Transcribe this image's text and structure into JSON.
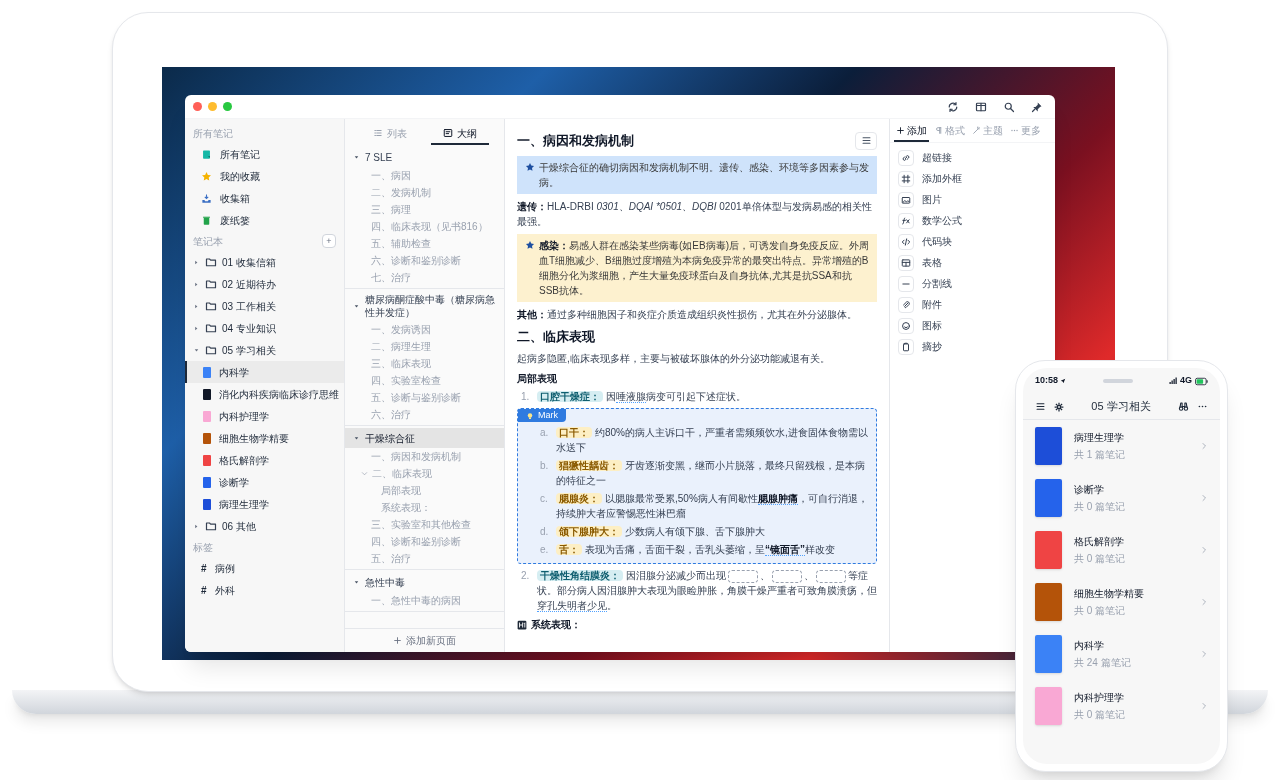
{
  "window": {
    "toolbar": [
      {
        "kind": "refresh"
      },
      {
        "kind": "columns"
      },
      {
        "kind": "search"
      },
      {
        "kind": "pin"
      }
    ]
  },
  "sidebar": {
    "library_header": "所有笔记",
    "library": [
      {
        "kind": "notes",
        "label": "所有笔记"
      },
      {
        "kind": "star",
        "label": "我的收藏"
      },
      {
        "kind": "inbox",
        "label": "收集箱"
      },
      {
        "kind": "trash",
        "label": "废纸篓"
      }
    ],
    "notebooks_header": "笔记本",
    "add_button": "+",
    "notebooks": [
      {
        "label": "01 收集信箱",
        "expanded": false
      },
      {
        "label": "02 近期待办",
        "expanded": false
      },
      {
        "label": "03 工作相关",
        "expanded": false
      },
      {
        "label": "04 专业知识",
        "expanded": false
      },
      {
        "label": "05 学习相关",
        "expanded": true,
        "children": [
          {
            "label": "内科学",
            "color": "#3b82f6",
            "selected": true
          },
          {
            "label": "消化内科疾病临床诊疗思维",
            "color": "#111827",
            "selected": false
          },
          {
            "label": "内科护理学",
            "color": "#f9a8d4",
            "selected": false
          },
          {
            "label": "细胞生物学精要",
            "color": "#b45309",
            "selected": false
          },
          {
            "label": "格氏解剖学",
            "color": "#ef4444",
            "selected": false
          },
          {
            "label": "诊断学",
            "color": "#2563eb",
            "selected": false
          },
          {
            "label": "病理生理学",
            "color": "#1d4ed8",
            "selected": false
          }
        ]
      },
      {
        "label": "06 其他",
        "expanded": false
      }
    ],
    "tags_header": "标签",
    "tags": [
      {
        "symbol": "#",
        "label": "病例"
      },
      {
        "symbol": "#",
        "label": "外科"
      }
    ]
  },
  "outline": {
    "tabs": [
      {
        "kind": "list",
        "label": "列表",
        "selected": false
      },
      {
        "kind": "outline",
        "label": "大纲",
        "selected": true
      }
    ],
    "groups": [
      {
        "title": "7 SLE",
        "expanded": true,
        "selected": false,
        "items": [
          {
            "label": "一、病因"
          },
          {
            "label": "二、发病机制"
          },
          {
            "label": "三、病理"
          },
          {
            "label": "四、临床表现（见书816）"
          },
          {
            "label": "五、辅助检查"
          },
          {
            "label": "六、诊断和鉴别诊断"
          },
          {
            "label": "七、治疗"
          }
        ]
      },
      {
        "title": "糖尿病酮症酸中毒（糖尿病急性并发症）",
        "expanded": true,
        "selected": false,
        "items": [
          {
            "label": "一、发病诱因"
          },
          {
            "label": "二、病理生理"
          },
          {
            "label": "三、临床表现"
          },
          {
            "label": "四、实验室检查"
          },
          {
            "label": "五、诊断与鉴别诊断"
          },
          {
            "label": "六、治疗"
          }
        ]
      },
      {
        "title": "干燥综合征",
        "expanded": true,
        "selected": true,
        "items": [
          {
            "label": "一、病因和发病机制"
          },
          {
            "label": "二、临床表现",
            "expanded": true,
            "children": [
              {
                "label": "局部表现"
              },
              {
                "label": "系统表现："
              }
            ]
          },
          {
            "label": "三、实验室和其他检查"
          },
          {
            "label": "四、诊断和鉴别诊断"
          },
          {
            "label": "五、治疗"
          }
        ]
      },
      {
        "title": "急性中毒",
        "expanded": true,
        "selected": false,
        "items": [
          {
            "label": "一、急性中毒的病因"
          }
        ]
      }
    ],
    "add_button": "添加新页面"
  },
  "editor": {
    "blocks": [
      {
        "kind": "heading",
        "text": "一、病因和发病机制"
      },
      {
        "kind": "callout",
        "color": "#cfe3fb",
        "segments": [
          {
            "text": "干燥综合征的确切病因和发病机制不明。遗传、感染、环境等多因素参与发病。"
          }
        ]
      },
      {
        "kind": "para",
        "segments": [
          {
            "text": "遗传：",
            "kind": "bold"
          },
          {
            "text": "HLA-DRBI "
          },
          {
            "text": "0301",
            "kind": "italic"
          },
          {
            "text": "、"
          },
          {
            "text": "DQAI *0501",
            "kind": "italic"
          },
          {
            "text": "、"
          },
          {
            "text": "DQBI",
            "kind": "italic"
          },
          {
            "text": " 0201单倍体型与发病易感的相关性最强。"
          }
        ]
      },
      {
        "kind": "callout",
        "color": "#fdf1cf",
        "segments": [
          {
            "text": "感染：",
            "kind": "bold"
          },
          {
            "text": "易感人群在感染某些病毒(如EB病毒)后，可诱发自身免疫反应。外周血T细胞减少、B细胞过度增殖为本病免疫异常的最突出特点。异常增殖的B细胞分化为浆细胞，产生大量免疫球蛋白及自身抗体,尤其是抗SSA和抗SSB抗体。"
          }
        ]
      },
      {
        "kind": "para",
        "segments": [
          {
            "text": "其他：",
            "kind": "bold"
          },
          {
            "text": "通过多种细胞因子和炎症介质造成组织炎性损伤，尤其在外分泌腺体。"
          }
        ]
      },
      {
        "kind": "heading",
        "text": "二、临床表现"
      },
      {
        "kind": "para",
        "segments": [
          {
            "text": "起病多隐匿,临床表现多样，主要与被破坏腺体的外分泌功能减退有关。"
          }
        ]
      },
      {
        "kind": "subheading",
        "text": "局部表现"
      },
      {
        "kind": "item",
        "marker": "1.",
        "segments": [
          {
            "text": "口腔干燥症：",
            "kind": "tag_blue"
          },
          {
            "text": "因"
          },
          {
            "text": "唾液腺",
            "kind": "underline"
          },
          {
            "text": "病变可引起下述症状。"
          }
        ]
      },
      {
        "kind": "mark",
        "label": "Mark",
        "items": [
          {
            "marker": "a.",
            "segments": [
              {
                "text": "口干：",
                "kind": "tag_yellow"
              },
              {
                "text": "约80%的病人主诉口干，严重者需频频饮水,进食固体食物需以水送下"
              }
            ]
          },
          {
            "marker": "b.",
            "segments": [
              {
                "text": "猖獗性龋齿：",
                "kind": "tag_yellow"
              },
              {
                "text": "牙齿逐渐变黑，继而小片脱落，最终只留残根，是本病的特征之一"
              }
            ]
          },
          {
            "marker": "c.",
            "segments": [
              {
                "text": "腮腺炎：",
                "kind": "tag_yellow"
              },
              {
                "text": "以腮腺最常受累,50%病人有间歇性"
              },
              {
                "text": "腮腺肿痛",
                "kind": "bold_underline"
              },
              {
                "text": "，可自行消退，持续肿大者应警惕恶性淋巴瘤"
              }
            ]
          },
          {
            "marker": "d.",
            "segments": [
              {
                "text": "颌下腺肿大：",
                "kind": "tag_yellow"
              },
              {
                "text": "少数病人有颌下腺、舌下腺肿大"
              }
            ]
          },
          {
            "marker": "e.",
            "segments": [
              {
                "text": "舌：",
                "kind": "tag_yellow"
              },
              {
                "text": "表现为舌痛，舌面干裂，舌乳头萎缩，呈"
              },
              {
                "text": "“镜面舌”",
                "kind": "bold_underline"
              },
              {
                "text": "样改变"
              }
            ]
          }
        ]
      },
      {
        "kind": "item",
        "marker": "2.",
        "segments": [
          {
            "text": "干燥性角结膜炎：",
            "kind": "tag_blue"
          },
          {
            "text": "因泪腺分泌减少而出现"
          },
          {
            "kind": "blank"
          },
          {
            "text": "、"
          },
          {
            "kind": "blank"
          },
          {
            "text": "、"
          },
          {
            "kind": "blank"
          },
          {
            "text": "等症状。部分病人因泪腺肿大表现为眼睑肿胀，角膜干燥严重者可致角膜溃疡，但"
          },
          {
            "text": "穿孔失明者少见",
            "kind": "underline"
          },
          {
            "text": "。"
          }
        ]
      },
      {
        "kind": "subheading_icon",
        "text": "系统表现："
      }
    ]
  },
  "panel": {
    "tabs": [
      {
        "kind": "plus",
        "label": "添加",
        "selected": true
      },
      {
        "kind": "format",
        "label": "格式",
        "selected": false
      },
      {
        "kind": "theme",
        "label": "主题",
        "selected": false
      },
      {
        "kind": "more",
        "label": "更多",
        "selected": false
      }
    ],
    "items": [
      {
        "kind": "link",
        "label": "超链接"
      },
      {
        "kind": "frame",
        "label": "添加外框"
      },
      {
        "kind": "image",
        "label": "图片"
      },
      {
        "kind": "formula",
        "label": "数学公式"
      },
      {
        "kind": "code",
        "label": "代码块"
      },
      {
        "kind": "table",
        "label": "表格"
      },
      {
        "kind": "divider",
        "label": "分割线"
      },
      {
        "kind": "attachment",
        "label": "附件"
      },
      {
        "kind": "emoji",
        "label": "图标"
      },
      {
        "kind": "clip",
        "label": "摘抄"
      }
    ]
  },
  "phone": {
    "time": "10:58",
    "network": "4G",
    "title": "05 学习相关",
    "books": [
      {
        "title": "病理生理学",
        "count": "共 1 篇笔记",
        "color": "#1d4ed8"
      },
      {
        "title": "诊断学",
        "count": "共 0 篇笔记",
        "color": "#2563eb"
      },
      {
        "title": "格氏解剖学",
        "count": "共 0 篇笔记",
        "color": "#ef4444"
      },
      {
        "title": "细胞生物学精要",
        "count": "共 0 篇笔记",
        "color": "#b45309"
      },
      {
        "title": "内科学",
        "count": "共 24 篇笔记",
        "color": "#3b82f6"
      },
      {
        "title": "内科护理学",
        "count": "共 0 篇笔记",
        "color": "#f9a8d4"
      }
    ]
  }
}
